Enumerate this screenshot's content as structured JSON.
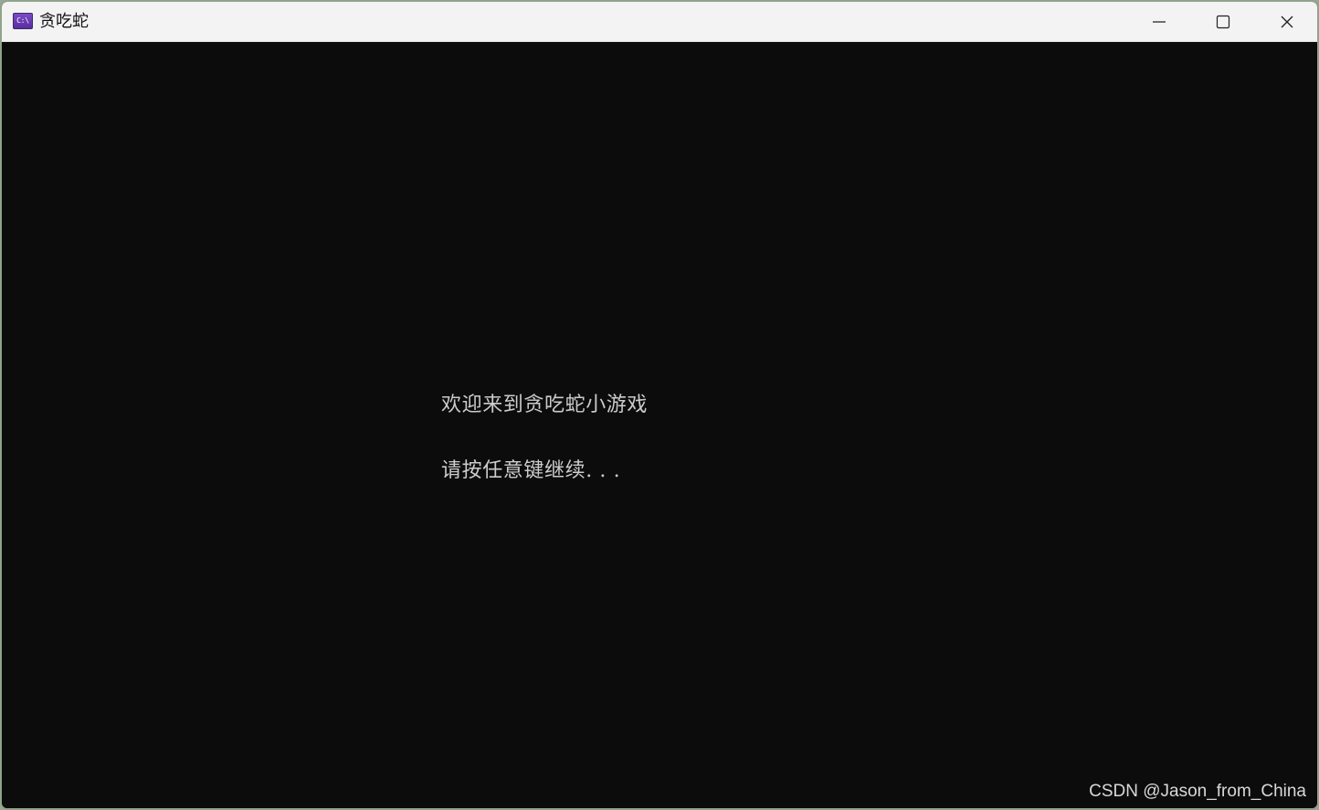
{
  "window": {
    "title": "贪吃蛇",
    "icon": {
      "name": "console-app-icon",
      "glyph": "C:\\"
    },
    "controls": {
      "minimize_icon": "minimize-icon",
      "maximize_icon": "maximize-icon",
      "close_icon": "close-icon"
    }
  },
  "console": {
    "lines": [
      "欢迎来到贪吃蛇小游戏",
      "请按任意键继续. . ."
    ],
    "text_color": "#cccccc",
    "background_color": "#0c0c0c"
  },
  "watermark": {
    "text": "CSDN @Jason_from_China"
  }
}
